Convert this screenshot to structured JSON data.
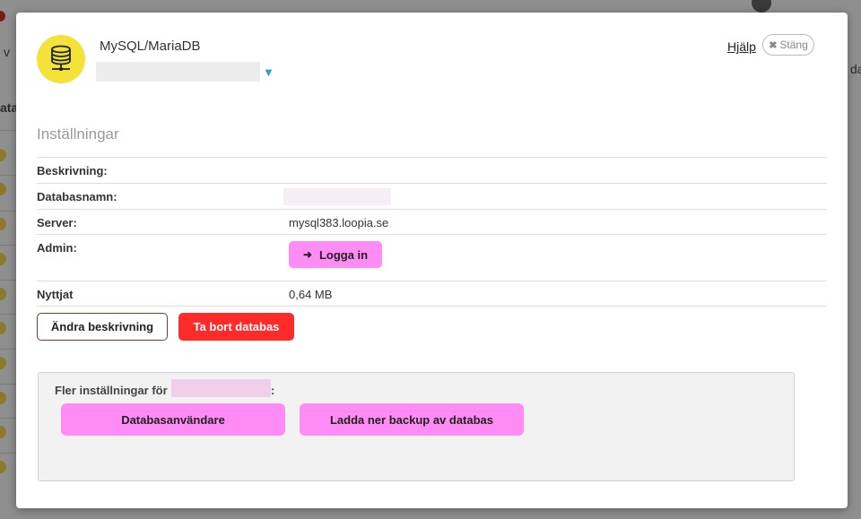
{
  "background": {
    "peek_text_left": "v",
    "peek_text_left2": "ata",
    "peek_text_right": "da"
  },
  "modal": {
    "icon": "database-server-icon",
    "title": "MySQL/MariaDB",
    "help_label": "Hjälp",
    "close_label": "Stäng",
    "section_title": "Inställningar",
    "rows": {
      "description": {
        "label": "Beskrivning:"
      },
      "dbname": {
        "label": "Databasnamn:"
      },
      "server": {
        "label": "Server:",
        "value": "mysql383.loopia.se"
      },
      "admin": {
        "label": "Admin:",
        "login_label": "Logga in"
      },
      "usage": {
        "label": "Nyttjat",
        "value": "0,64 MB"
      }
    },
    "edit_description_label": "Ändra beskrivning",
    "delete_database_label": "Ta bort databas",
    "more": {
      "label": "Fler inställningar för",
      "colon": ":",
      "db_users_label": "Databasanvändare",
      "backup_label": "Ladda ner backup av databas"
    }
  },
  "colors": {
    "accent_pink": "#ff8cf5",
    "danger_red": "#ff2a2a",
    "logo_yellow": "#f2e23a",
    "caret_blue": "#2a9ed8"
  }
}
